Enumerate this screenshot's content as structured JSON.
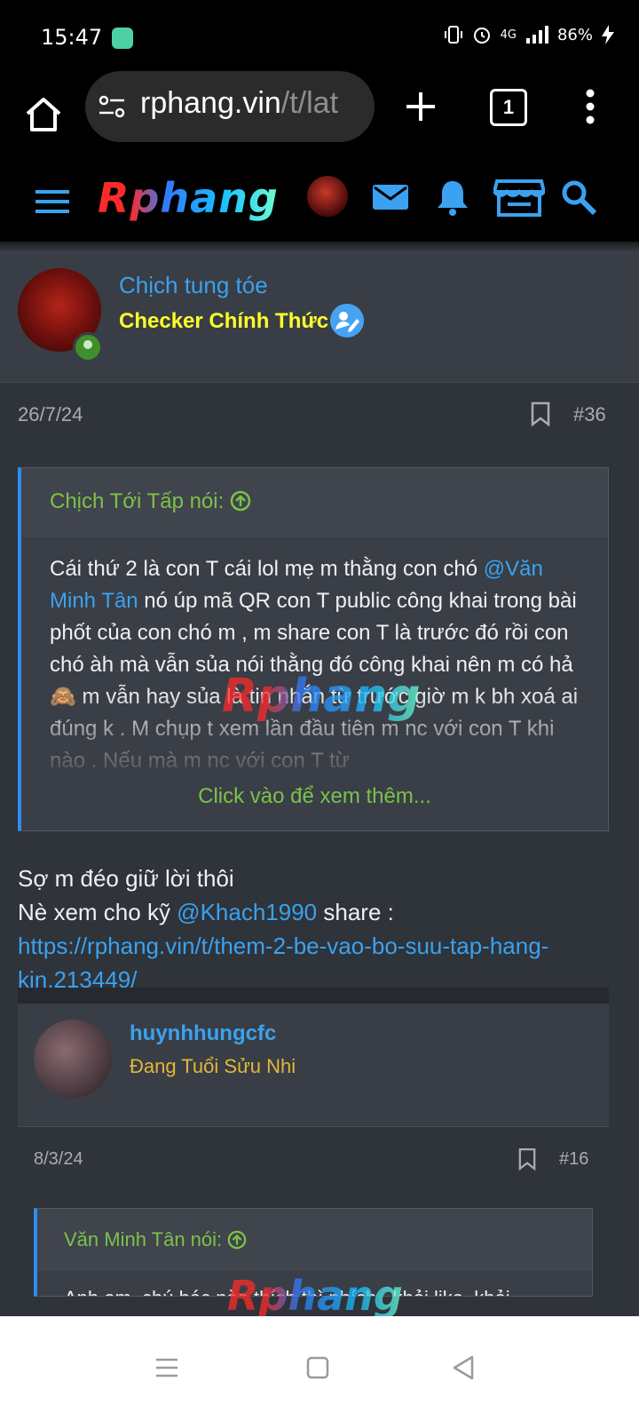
{
  "status": {
    "time": "15:47",
    "network": "4G",
    "battery": "86%"
  },
  "browser": {
    "url_host": "rphang.vin",
    "url_path": "/t/lat",
    "tab_count": "1"
  },
  "forum": {
    "logo": "Rphang"
  },
  "post": {
    "author": "Chịch tung tóe",
    "author_title": "Checker Chính Thức",
    "date": "26/7/24",
    "number": "#36",
    "quote": {
      "author": "Chịch Tới Tấp nói:",
      "pre": "Cái thứ 2 là con T cái lol mẹ m thằng con chó ",
      "mention": "@Văn Minh Tân",
      "post": " nó úp mã QR con T public công khai trong bài phốt của con chó m , m share con T là trước đó rồi con chó àh mà vẫn sủa nói thằng đó công khai nên m có hả🙈 m vẫn hay sủa là tin nhắn từ trước giờ m k bh xoá ai đúng k . M chụp t xem lần đầu tiên m nc với con T khi nào . Nếu mà m nc với con T từ",
      "more": "Click vào để xem thêm..."
    },
    "reply_line1": "Sợ m đéo giữ lời thôi",
    "reply_line2_pre": "Nè xem cho kỹ ",
    "reply_mention": "@Khach1990",
    "reply_line2_post": " share :",
    "reply_link": "https://rphang.vin/t/them-2-be-vao-bo-suu-tap-hang-kin.213449/"
  },
  "embedded": {
    "author": "huynhhungcfc",
    "author_title": "Đang Tuổi Sửu Nhi",
    "date": "8/3/24",
    "number": "#16",
    "quote_author": "Văn Minh Tân nói:",
    "quote_text": "Anh em, chú bác nào thích thì nhích , khỏi like, khỏi"
  },
  "watermark": "Rphang"
}
